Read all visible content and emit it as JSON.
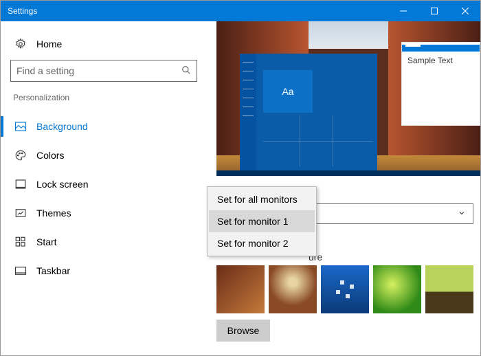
{
  "window": {
    "title": "Settings"
  },
  "sidebar": {
    "home": "Home",
    "search_placeholder": "Find a setting",
    "category": "Personalization",
    "items": [
      {
        "label": "Background",
        "icon": "picture-icon",
        "active": true
      },
      {
        "label": "Colors",
        "icon": "palette-icon",
        "active": false
      },
      {
        "label": "Lock screen",
        "icon": "lockframe-icon",
        "active": false
      },
      {
        "label": "Themes",
        "icon": "pencilframe-icon",
        "active": false
      },
      {
        "label": "Start",
        "icon": "startgrid-icon",
        "active": false
      },
      {
        "label": "Taskbar",
        "icon": "taskbar-icon",
        "active": false
      }
    ]
  },
  "preview": {
    "tile_text": "Aa",
    "sample_window": "Sample Text"
  },
  "content": {
    "picture_label": "ure",
    "browse_label": "Browse"
  },
  "context_menu": {
    "items": [
      {
        "label": "Set for all monitors",
        "highlight": false
      },
      {
        "label": "Set for monitor 1",
        "highlight": true
      },
      {
        "label": "Set for monitor 2",
        "highlight": false
      }
    ]
  }
}
